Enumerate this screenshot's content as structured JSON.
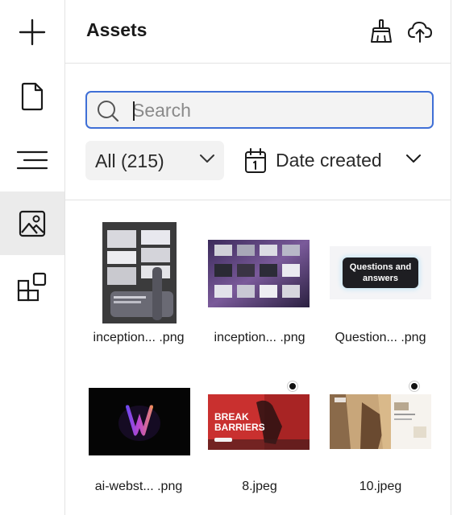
{
  "rail": {
    "items": [
      {
        "icon": "plus-icon",
        "active": false
      },
      {
        "icon": "page-icon",
        "active": false
      },
      {
        "icon": "menu-lines-icon",
        "active": false
      },
      {
        "icon": "image-icon",
        "active": true
      },
      {
        "icon": "components-icon",
        "active": false
      }
    ]
  },
  "header": {
    "title": "Assets",
    "clean_icon": "broom-icon",
    "upload_icon": "cloud-upload-icon"
  },
  "search": {
    "placeholder": "Search",
    "value": ""
  },
  "filter": {
    "selected": "All (215)"
  },
  "sort": {
    "selected": "Date created"
  },
  "assets": [
    {
      "label": "inception... .png",
      "marked": false
    },
    {
      "label": "inception... .png",
      "marked": false
    },
    {
      "label": "Question... .png",
      "marked": false,
      "thumb_text": "Questions and answers"
    },
    {
      "label": "ai-webst... .png",
      "marked": false
    },
    {
      "label": "8.jpeg",
      "marked": true,
      "thumb_text": "BREAK BARRIERS"
    },
    {
      "label": "10.jpeg",
      "marked": true
    }
  ],
  "colors": {
    "accent": "#3f6fd6",
    "active_rail": "#ebebeb",
    "border": "#e3e3e3"
  }
}
